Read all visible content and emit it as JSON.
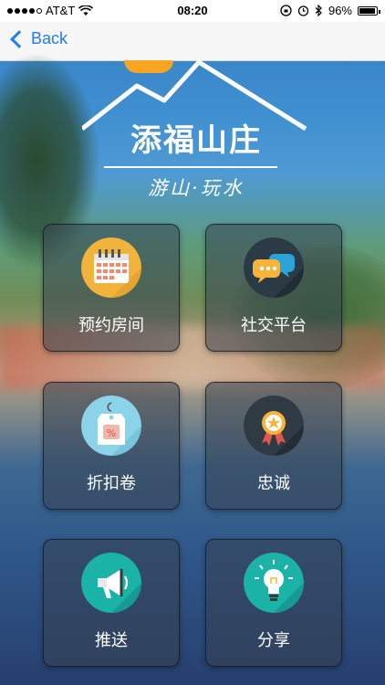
{
  "status_bar": {
    "carrier": "AT&T",
    "time": "08:20",
    "battery": "96%",
    "battery_level": 0.96
  },
  "nav": {
    "back_label": "Back"
  },
  "logo": {
    "title": "添福山庄",
    "subtitle": "游山·玩水"
  },
  "tiles": [
    {
      "label": "预约房间",
      "icon": "calendar-icon",
      "color": "#f2b33d"
    },
    {
      "label": "社交平台",
      "icon": "chat-bubbles-icon",
      "color": "#2b3a44"
    },
    {
      "label": "折扣卷",
      "icon": "discount-tag-icon",
      "color": "#8cd3ea"
    },
    {
      "label": "忠诚",
      "icon": "award-ribbon-icon",
      "color": "#2f3a44"
    },
    {
      "label": "推送",
      "icon": "megaphone-icon",
      "color": "#1bb2a8"
    },
    {
      "label": "分享",
      "icon": "lightbulb-icon",
      "color": "#1bb2a8"
    }
  ]
}
